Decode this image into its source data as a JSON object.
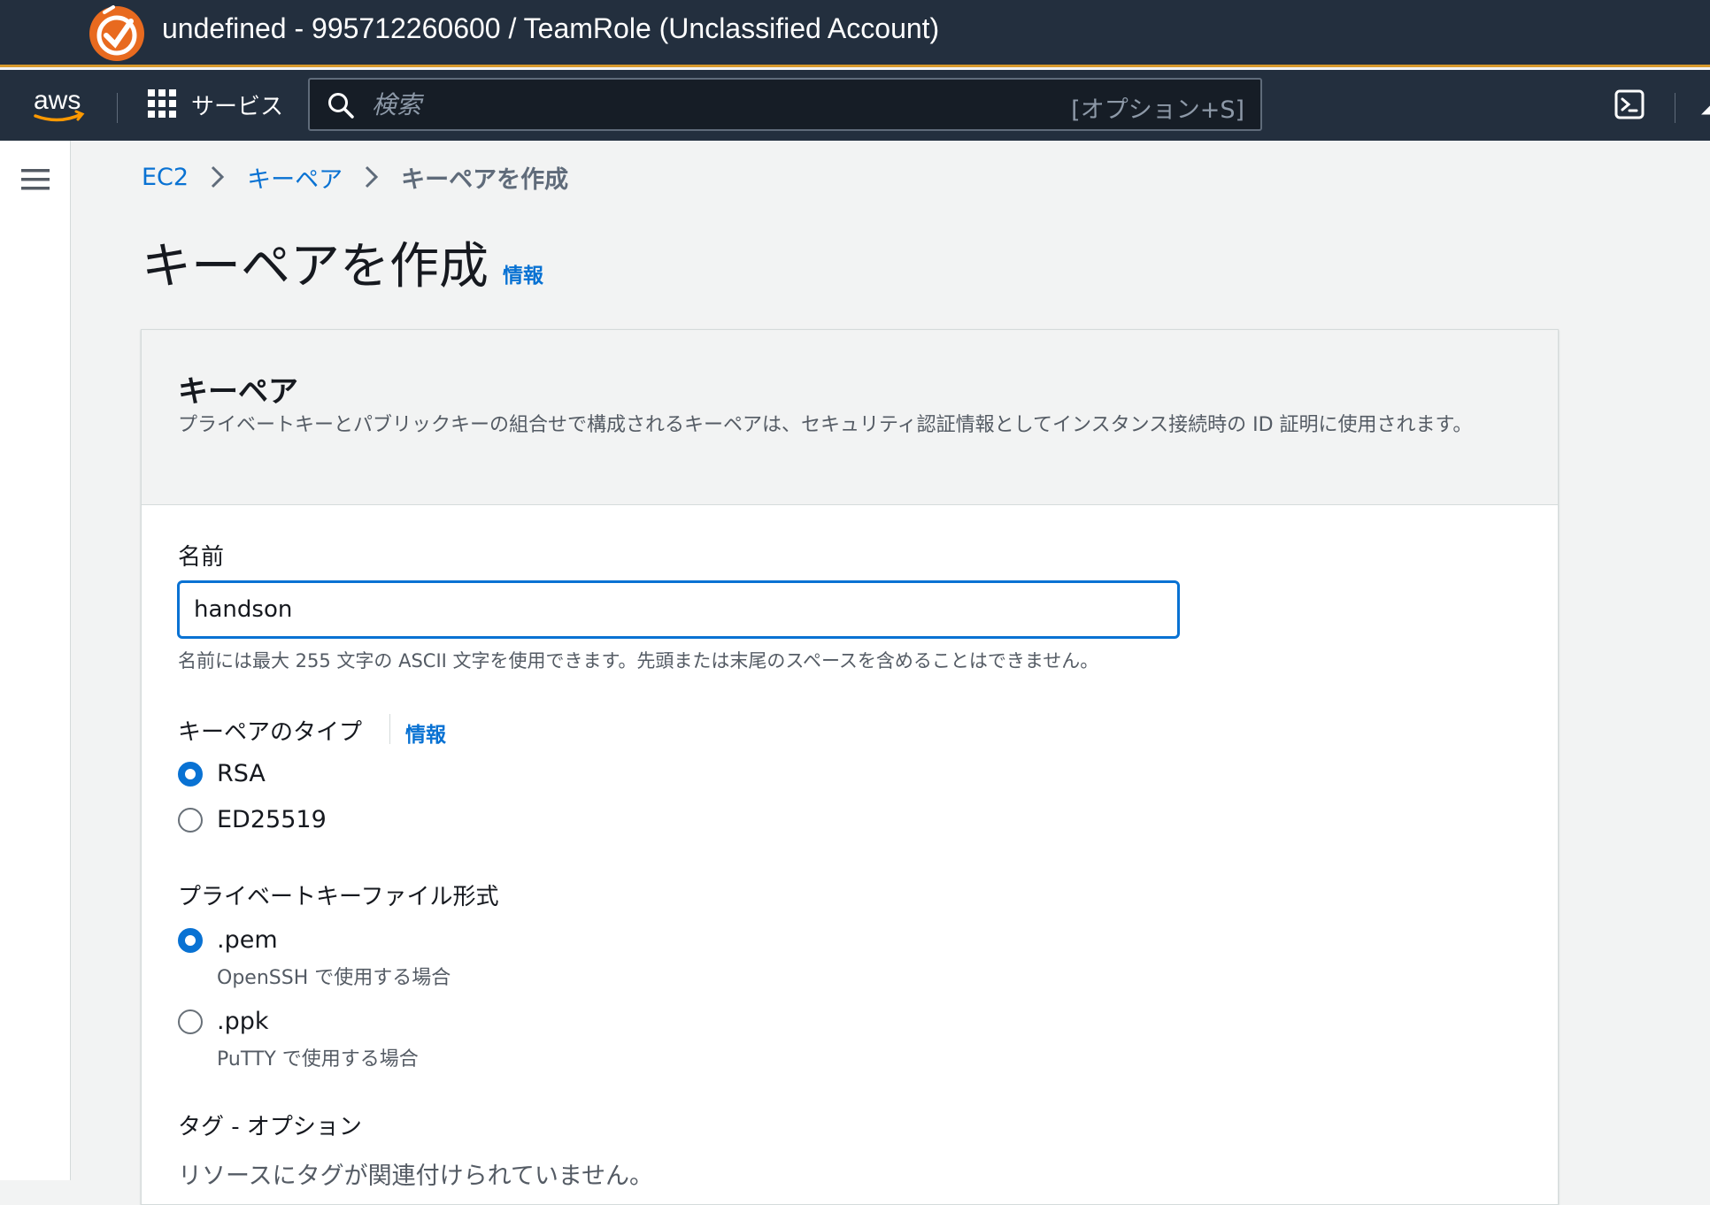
{
  "account_bar": {
    "title": "undefined - 995712260600 / TeamRole (Unclassified Account)"
  },
  "nav": {
    "services_label": "サービス",
    "search_placeholder": "検索",
    "search_shortcut": "[オプション+S]"
  },
  "breadcrumb": {
    "items": [
      "EC2",
      "キーペア"
    ],
    "current": "キーペアを作成"
  },
  "page": {
    "title": "キーペアを作成",
    "info_link": "情報"
  },
  "keypair_panel": {
    "title": "キーペア",
    "description": "プライベートキーとパブリックキーの組合せで構成されるキーペアは、セキュリティ認証情報としてインスタンス接続時の ID 証明に使用されます。",
    "name_label": "名前",
    "name_value": "handson",
    "name_hint": "名前には最大 255 文字の ASCII 文字を使用できます。先頭または末尾のスペースを含めることはできません。",
    "type_label": "キーペアのタイプ",
    "type_info": "情報",
    "type_options": [
      {
        "label": "RSA",
        "checked": true
      },
      {
        "label": "ED25519",
        "checked": false
      }
    ],
    "format_label": "プライベートキーファイル形式",
    "format_options": [
      {
        "label": ".pem",
        "desc": "OpenSSH で使用する場合",
        "checked": true
      },
      {
        "label": ".ppk",
        "desc": "PuTTY で使用する場合",
        "checked": false
      }
    ],
    "tags_label": "タグ - オプション",
    "tags_empty": "リソースにタグが関連付けられていません。"
  },
  "colors": {
    "nav_bg": "#232f3e",
    "accent_orange": "#ff9900",
    "link_blue": "#0972d3"
  },
  "icons": [
    "account-logo-icon",
    "aws-logo-icon",
    "grid-icon",
    "search-icon",
    "cloudshell-icon",
    "menu-icon",
    "chevron-right-icon"
  ]
}
